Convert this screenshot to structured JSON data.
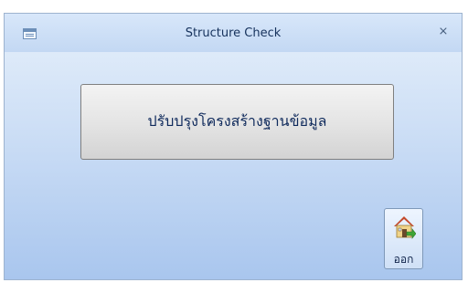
{
  "window": {
    "title": "Structure Check",
    "close_label": "⨯"
  },
  "main": {
    "update_button_label": "ปรับปรุงโครงสร้างฐานข้อมูล"
  },
  "footer": {
    "exit_button_label": "ออก",
    "exit_icon": "home-exit-icon"
  }
}
